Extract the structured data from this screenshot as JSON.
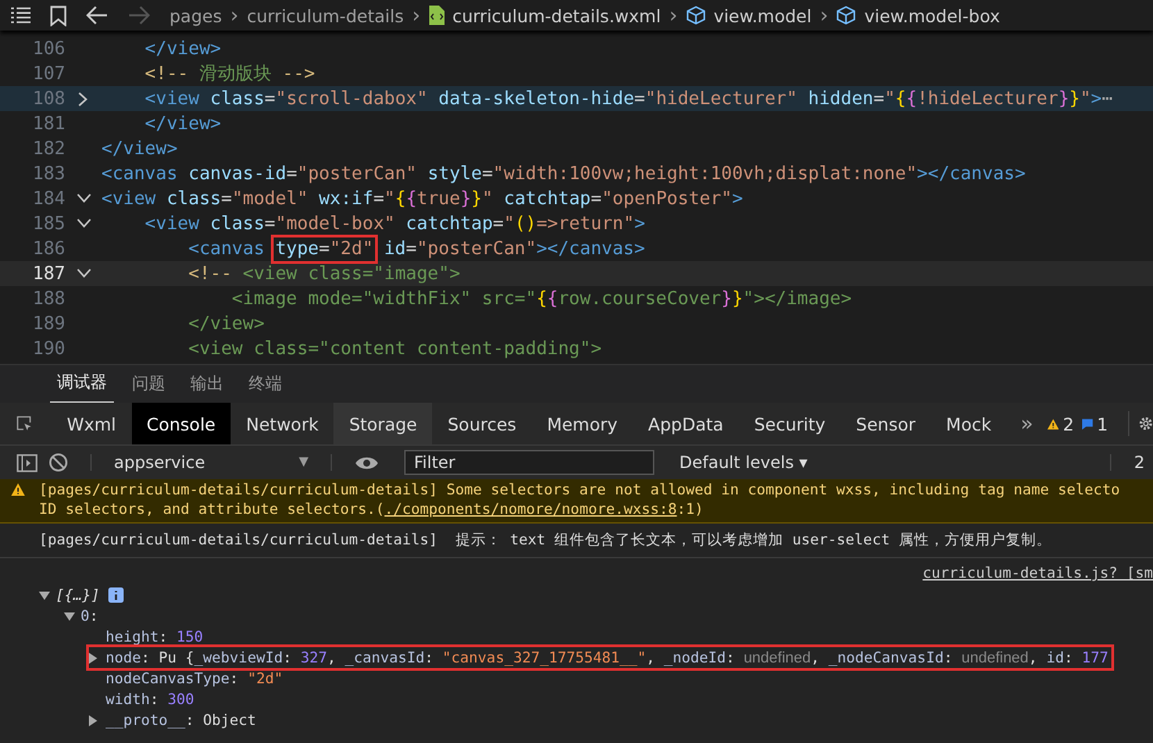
{
  "breadcrumb": {
    "back_disabled": false,
    "forward_disabled": true,
    "items": [
      {
        "label": "pages",
        "kind": "plain"
      },
      {
        "separator": "›",
        "label": "curriculum-details",
        "kind": "plain"
      },
      {
        "separator": "›",
        "label": "curriculum-details.wxml",
        "kind": "file"
      },
      {
        "separator": "›",
        "label": "view.model",
        "kind": "element"
      },
      {
        "separator": "›",
        "label": "view.model-box",
        "kind": "element"
      }
    ]
  },
  "editor": {
    "lines": [
      {
        "number": "106",
        "hovered": false,
        "current": false,
        "tokens": [
          {
            "kind": "tag",
            "text": "    </view>"
          }
        ]
      },
      {
        "number": "107",
        "hovered": false,
        "current": false,
        "tokens": [
          {
            "kind": "comment",
            "text": "    <!-- "
          },
          {
            "kind": "comment_body",
            "text": "滑动版块"
          },
          {
            "kind": "comment",
            "text": " -->"
          }
        ]
      },
      {
        "number": "108",
        "hovered": true,
        "current": false,
        "expanded": false,
        "tokens": [
          {
            "kind": "tag",
            "text": "    <view"
          },
          {
            "kind": "attr",
            "text": " class"
          },
          {
            "kind": "punct",
            "text": "="
          },
          {
            "kind": "string",
            "text": "\"scroll-dabox\""
          },
          {
            "kind": "attr",
            "text": " data-skeleton-hide"
          },
          {
            "kind": "punct",
            "text": "="
          },
          {
            "kind": "string",
            "text": "\"hideLecturer\""
          },
          {
            "kind": "attr",
            "text": " hidden"
          },
          {
            "kind": "punct",
            "text": "="
          },
          {
            "kind": "string",
            "text": "\""
          },
          {
            "kind": "brace1",
            "text": "{"
          },
          {
            "kind": "brace2",
            "text": "{"
          },
          {
            "kind": "string",
            "text": "!hideLecturer"
          },
          {
            "kind": "brace2",
            "text": "}"
          },
          {
            "kind": "brace1",
            "text": "}"
          },
          {
            "kind": "string",
            "text": "\""
          },
          {
            "kind": "tag",
            "text": ">"
          },
          {
            "kind": "ellipsis",
            "text": "⋯"
          }
        ]
      },
      {
        "number": "181",
        "hovered": false,
        "current": false,
        "tokens": [
          {
            "kind": "tag",
            "text": "    </view>"
          }
        ]
      },
      {
        "number": "182",
        "hovered": false,
        "current": false,
        "tokens": [
          {
            "kind": "tag",
            "text": "</view>"
          }
        ]
      },
      {
        "number": "183",
        "hovered": false,
        "current": false,
        "tokens": [
          {
            "kind": "tag",
            "text": "<canvas"
          },
          {
            "kind": "attr",
            "text": " canvas-id"
          },
          {
            "kind": "punct",
            "text": "="
          },
          {
            "kind": "string",
            "text": "\"posterCan\""
          },
          {
            "kind": "attr",
            "text": " style"
          },
          {
            "kind": "punct",
            "text": "="
          },
          {
            "kind": "string",
            "text": "\"width:100vw;height:100vh;displat:none\""
          },
          {
            "kind": "tag",
            "text": "></canvas>"
          }
        ]
      },
      {
        "number": "184",
        "hovered": false,
        "current": false,
        "expanded": true,
        "tokens": [
          {
            "kind": "tag",
            "text": "<view"
          },
          {
            "kind": "attr",
            "text": " class"
          },
          {
            "kind": "punct",
            "text": "="
          },
          {
            "kind": "string",
            "text": "\"model\""
          },
          {
            "kind": "attr",
            "text": " wx:if"
          },
          {
            "kind": "punct",
            "text": "="
          },
          {
            "kind": "string",
            "text": "\""
          },
          {
            "kind": "brace1",
            "text": "{"
          },
          {
            "kind": "brace2",
            "text": "{"
          },
          {
            "kind": "string",
            "text": "true"
          },
          {
            "kind": "brace2",
            "text": "}"
          },
          {
            "kind": "brace1",
            "text": "}"
          },
          {
            "kind": "string",
            "text": "\""
          },
          {
            "kind": "attr",
            "text": " catchtap"
          },
          {
            "kind": "punct",
            "text": "="
          },
          {
            "kind": "string",
            "text": "\"openPoster\""
          },
          {
            "kind": "tag",
            "text": ">"
          }
        ]
      },
      {
        "number": "185",
        "hovered": false,
        "current": false,
        "expanded": true,
        "tokens": [
          {
            "kind": "tag",
            "text": "    <view"
          },
          {
            "kind": "attr",
            "text": " class"
          },
          {
            "kind": "punct",
            "text": "="
          },
          {
            "kind": "string",
            "text": "\"model-box\""
          },
          {
            "kind": "attr",
            "text": " catchtap"
          },
          {
            "kind": "punct",
            "text": "="
          },
          {
            "kind": "string",
            "text": "\""
          },
          {
            "kind": "brace1",
            "text": "()"
          },
          {
            "kind": "string",
            "text": "=>return\""
          },
          {
            "kind": "tag",
            "text": ">"
          }
        ]
      },
      {
        "number": "186",
        "hovered": false,
        "current": false,
        "tokens": [
          {
            "kind": "tag",
            "text": "        <canvas"
          },
          {
            "kind": "box",
            "parts": [
              {
                "kind": "attr",
                "text": "type"
              },
              {
                "kind": "punct",
                "text": "="
              },
              {
                "kind": "string",
                "text": "\"2d\""
              }
            ]
          },
          {
            "kind": "attr",
            "text": " id"
          },
          {
            "kind": "punct",
            "text": "="
          },
          {
            "kind": "string",
            "text": "\"posterCan\""
          },
          {
            "kind": "tag",
            "text": "></canvas>"
          }
        ]
      },
      {
        "number": "187",
        "hovered": false,
        "current": true,
        "expanded": true,
        "tokens": [
          {
            "kind": "comment",
            "text": "        <!--"
          },
          {
            "kind": "comment_body",
            "text": " <view class=\"image\">"
          }
        ]
      },
      {
        "number": "188",
        "hovered": false,
        "current": false,
        "tokens": [
          {
            "kind": "comment_body",
            "text": "            <image mode=\"widthFix\" src=\""
          },
          {
            "kind": "brace1",
            "text": "{"
          },
          {
            "kind": "brace2",
            "text": "{"
          },
          {
            "kind": "comment_body",
            "text": "row.courseCover"
          },
          {
            "kind": "brace2",
            "text": "}"
          },
          {
            "kind": "brace1",
            "text": "}"
          },
          {
            "kind": "comment_body",
            "text": "\"></image>"
          }
        ]
      },
      {
        "number": "189",
        "hovered": false,
        "current": false,
        "tokens": [
          {
            "kind": "comment_body",
            "text": "        </view>"
          }
        ]
      },
      {
        "number": "190",
        "hovered": false,
        "current": false,
        "tokens": [
          {
            "kind": "comment_body",
            "text": "        <view class=\"content content-padding\">"
          }
        ]
      }
    ]
  },
  "panel_tabs": [
    {
      "label": "调试器",
      "selected": true
    },
    {
      "label": "问题",
      "selected": false
    },
    {
      "label": "输出",
      "selected": false
    },
    {
      "label": "终端",
      "selected": false
    }
  ],
  "devtools_tabs": [
    {
      "label": "Wxml",
      "selected": false,
      "hovered": false
    },
    {
      "label": "Console",
      "selected": true,
      "hovered": false
    },
    {
      "label": "Network",
      "selected": false,
      "hovered": false
    },
    {
      "label": "Storage",
      "selected": false,
      "hovered": true
    },
    {
      "label": "Sources",
      "selected": false,
      "hovered": false
    },
    {
      "label": "Memory",
      "selected": false,
      "hovered": false
    },
    {
      "label": "AppData",
      "selected": false,
      "hovered": false
    },
    {
      "label": "Security",
      "selected": false,
      "hovered": false
    },
    {
      "label": "Sensor",
      "selected": false,
      "hovered": false
    },
    {
      "label": "Mock",
      "selected": false,
      "hovered": false
    }
  ],
  "more_tabs": "»",
  "warning_count": "2",
  "message_count": "1",
  "filter_bar": {
    "context": "appservice",
    "context_caret": "▼",
    "filter_placeholder": "Filter",
    "levels": "Default levels ▾",
    "count": "2"
  },
  "console": {
    "warning": {
      "line1": "[pages/curriculum-details/curriculum-details] Some selectors are not allowed in component wxss, including tag name selecto",
      "line2_before": "ID selectors, and attribute selectors.(",
      "link": "./components/nomore/nomore.wxss:8",
      "line2_after": ":1)"
    },
    "info": "[pages/curriculum-details/curriculum-details]  提示： text 组件包含了长文本，可以考虑增加 user-select 属性，方便用户复制。",
    "source_link": "curriculum-details.js? [sm",
    "tree": [
      {
        "parts": [
          {
            "kind": "italic",
            "text": "[{…}]"
          }
        ],
        "expanded": true,
        "info_badge": true,
        "boxed": false,
        "children": [
          {
            "parts": [
              {
                "kind": "key",
                "text": "0"
              },
              {
                "kind": "plain",
                "text": ":"
              }
            ],
            "expanded": true,
            "boxed": false,
            "children": [
              {
                "parts": [
                  {
                    "kind": "key",
                    "text": "height"
                  },
                  {
                    "kind": "plain",
                    "text": ": "
                  },
                  {
                    "kind": "number",
                    "text": "150"
                  }
                ],
                "boxed": false
              },
              {
                "parts": [
                  {
                    "kind": "key",
                    "text": "node"
                  },
                  {
                    "kind": "plain",
                    "text": ": Pu {"
                  },
                  {
                    "kind": "key",
                    "text": "_webviewId"
                  },
                  {
                    "kind": "plain",
                    "text": ": "
                  },
                  {
                    "kind": "number",
                    "text": "327"
                  },
                  {
                    "kind": "plain",
                    "text": ", "
                  },
                  {
                    "kind": "key",
                    "text": "_canvasId"
                  },
                  {
                    "kind": "plain",
                    "text": ": "
                  },
                  {
                    "kind": "string",
                    "text": "\"canvas_327_17755481__\""
                  },
                  {
                    "kind": "plain",
                    "text": ", "
                  },
                  {
                    "kind": "key",
                    "text": "_nodeId"
                  },
                  {
                    "kind": "plain",
                    "text": ": "
                  },
                  {
                    "kind": "undef",
                    "text": "undefined"
                  },
                  {
                    "kind": "plain",
                    "text": ", "
                  },
                  {
                    "kind": "key",
                    "text": "_nodeCanvasId"
                  },
                  {
                    "kind": "plain",
                    "text": ": "
                  },
                  {
                    "kind": "undef",
                    "text": "undefined"
                  },
                  {
                    "kind": "plain",
                    "text": ", "
                  },
                  {
                    "kind": "key",
                    "text": "id"
                  },
                  {
                    "kind": "plain",
                    "text": ": "
                  },
                  {
                    "kind": "number",
                    "text": "177"
                  }
                ],
                "expanded": false,
                "boxed": true
              },
              {
                "parts": [
                  {
                    "kind": "key",
                    "text": "nodeCanvasType"
                  },
                  {
                    "kind": "plain",
                    "text": ": "
                  },
                  {
                    "kind": "string",
                    "text": "\"2d\""
                  }
                ],
                "boxed": false
              },
              {
                "parts": [
                  {
                    "kind": "key",
                    "text": "width"
                  },
                  {
                    "kind": "plain",
                    "text": ": "
                  },
                  {
                    "kind": "number",
                    "text": "300"
                  }
                ],
                "boxed": false
              },
              {
                "parts": [
                  {
                    "kind": "key",
                    "text": "__proto__"
                  },
                  {
                    "kind": "plain",
                    "text": ": Object"
                  }
                ],
                "expanded": false,
                "boxed": false
              }
            ]
          }
        ]
      }
    ]
  }
}
